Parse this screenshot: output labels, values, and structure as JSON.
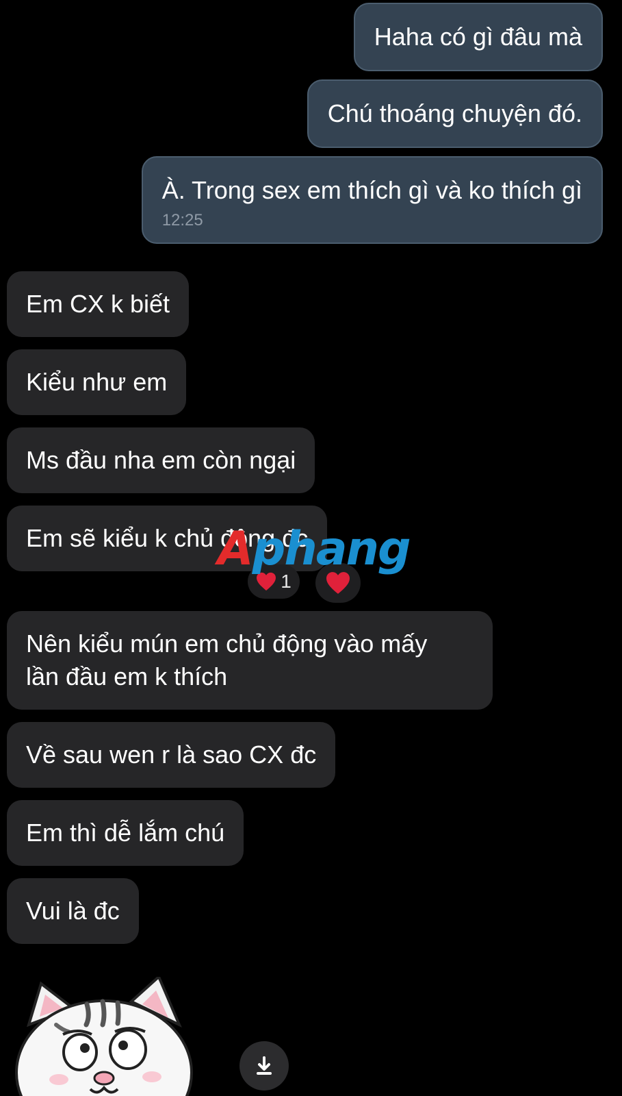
{
  "messages": {
    "out_1": "Haha có gì đâu mà",
    "out_2": "Chú thoáng chuyện đó.",
    "out_3": "À. Trong sex em thích gì và ko thích gì",
    "out_3_time": "12:25",
    "in_1": "Em CX k biết",
    "in_2": "Kiểu như em",
    "in_3": "Ms đầu nha em còn ngại",
    "in_4": "Em sẽ kiểu k chủ động đc",
    "in_5_line1": "Nên kiểu mún em chủ động vào mấy",
    "in_5_line2": "lần đầu em k thích",
    "in_6": "Về sau wen r là sao CX đc",
    "in_7": "Em thì dễ lắm chú",
    "in_8": "Vui là đc"
  },
  "reaction": {
    "count": "1",
    "icon": "heart-icon"
  },
  "watermark": {
    "part1": "A",
    "part2": "phang"
  },
  "icons": {
    "download": "download-arrow-icon",
    "sticker": "cat-sticker"
  },
  "colors": {
    "background": "#000000",
    "outgoing_bubble": "#344352",
    "incoming_bubble": "#262628",
    "heart": "#e0213a",
    "watermark_red": "#e32b2b",
    "watermark_blue": "#1a8fd0"
  }
}
